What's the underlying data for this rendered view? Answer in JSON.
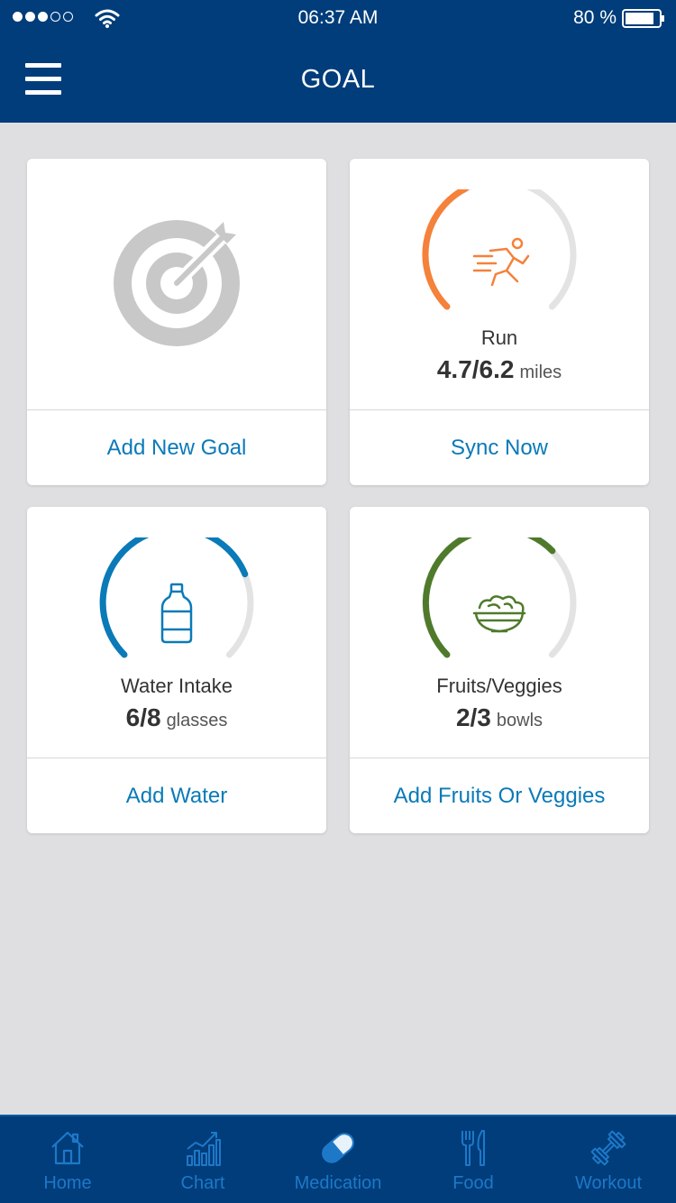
{
  "status": {
    "time": "06:37 AM",
    "battery": "80 %"
  },
  "header": {
    "title": "GOAL"
  },
  "cards": [
    {
      "action": "Add New Goal"
    },
    {
      "name": "Run",
      "value": "4.7/6.2",
      "unit": "miles",
      "progress": 0.4,
      "color": "#f5813a",
      "action": "Sync Now"
    },
    {
      "name": "Water Intake",
      "value": "6/8",
      "unit": "glasses",
      "progress": 0.75,
      "color": "#0a7ab8",
      "action": "Add Water"
    },
    {
      "name": "Fruits/Veggies",
      "value": "2/3",
      "unit": "bowls",
      "progress": 0.67,
      "color": "#4f7a2b",
      "action": "Add Fruits Or Veggies"
    }
  ],
  "tabs": [
    {
      "label": "Home",
      "icon": "home-icon"
    },
    {
      "label": "Chart",
      "icon": "chart-icon"
    },
    {
      "label": "Medication",
      "icon": "pill-icon"
    },
    {
      "label": "Food",
      "icon": "fork-knife-icon"
    },
    {
      "label": "Workout",
      "icon": "dumbbell-icon"
    }
  ],
  "colors": {
    "brand": "#003d7a",
    "accent": "#0a7ab8",
    "track": "#e3e3e3",
    "tab": "#1e78c8"
  }
}
